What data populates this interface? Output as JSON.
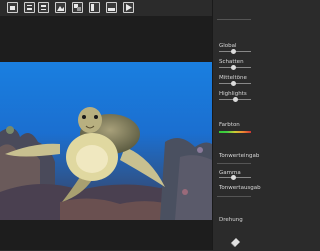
{
  "toolbar": {
    "tools": [
      {
        "name": "open-tool",
        "icon": "folder-icon"
      },
      {
        "name": "crop-tool",
        "icon": "crop-icon"
      },
      {
        "name": "adjust-tool",
        "icon": "adjust-icon"
      },
      {
        "name": "filter-tool",
        "icon": "landscape-icon"
      },
      {
        "name": "layers-tool",
        "icon": "layers-icon"
      },
      {
        "name": "split-tool",
        "icon": "split-icon"
      },
      {
        "name": "frame-tool",
        "icon": "frame-icon"
      },
      {
        "name": "play-tool",
        "icon": "play-icon"
      }
    ]
  },
  "sidebar": {
    "global_label": "Global",
    "shadows_label": "Schatten",
    "midtones_label": "Mitteltöne",
    "highlights_label": "Highlights",
    "hue_label": "Farbton",
    "input_tone_label": "Tonwerteingab",
    "gamma_label": "Gamma",
    "output_tone_label": "Tonwertausgab",
    "rotation_label": "Drehung",
    "sliders": {
      "global": 0.45,
      "shadows": 0.45,
      "midtones": 0.45,
      "highlights": 0.5,
      "gamma": 0.45
    }
  },
  "colors": {
    "accent_blue": "#2a5cc8",
    "background": "#2b2b2b",
    "canvas": "#1d1d1d"
  }
}
